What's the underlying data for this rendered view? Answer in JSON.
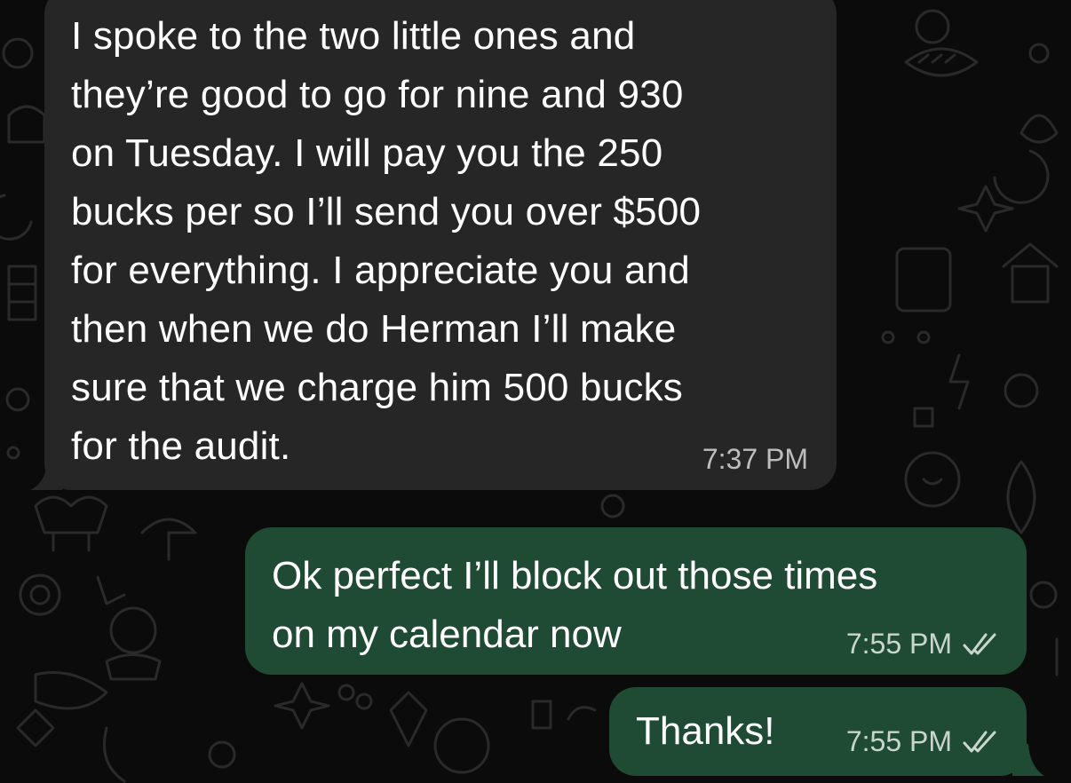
{
  "messages": [
    {
      "direction": "incoming",
      "text": "I spoke to the two little ones and\nthey’re good to go for nine and 930\non Tuesday. I will pay you the 250\nbucks per so I’ll send you over $500\nfor everything. I appreciate you and\nthen when we do Herman I’ll make\nsure that we charge him 500 bucks\nfor the audit.",
      "time": "7:37 PM"
    },
    {
      "direction": "outgoing",
      "text": "Ok perfect I’ll block out those times\non my calendar now",
      "time": "7:55 PM",
      "status": "read"
    },
    {
      "direction": "outgoing",
      "text": "Thanks!",
      "time": "7:55 PM",
      "status": "read"
    }
  ],
  "colors": {
    "background": "#0b0b0b",
    "incoming_bubble": "#262626",
    "outgoing_bubble": "#1f4a34",
    "text": "#ffffff",
    "timestamp": "#bdbdbd"
  },
  "icons": {
    "read_receipt": "double-check-icon"
  }
}
